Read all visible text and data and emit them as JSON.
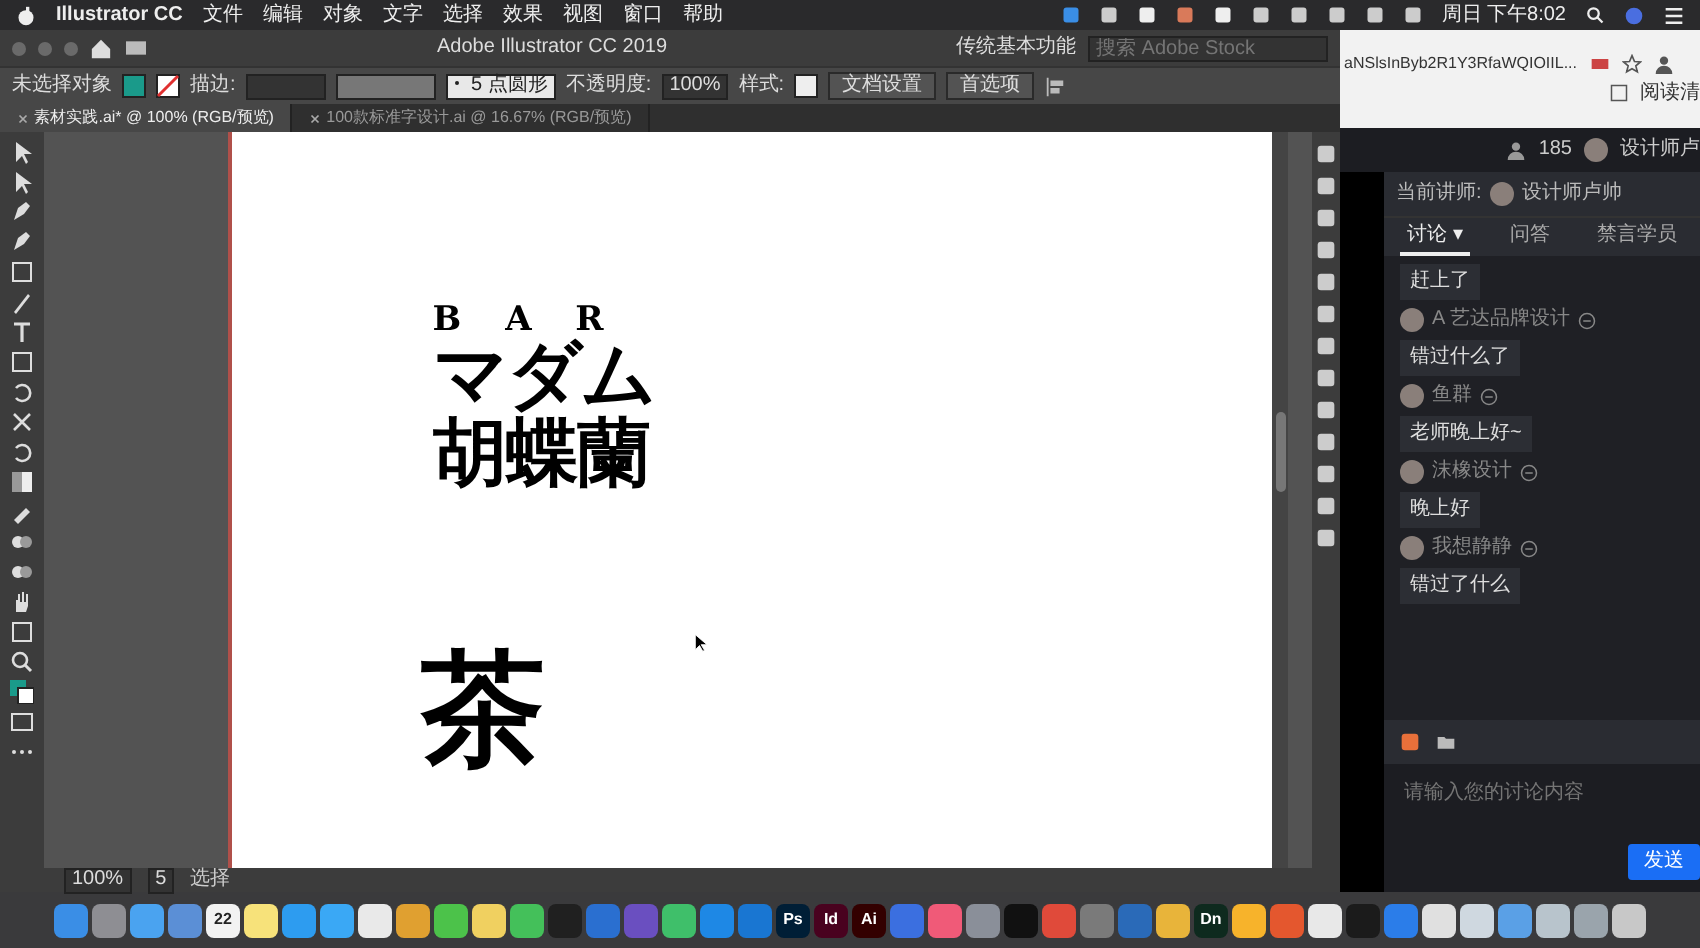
{
  "menubar": {
    "app": "Illustrator CC",
    "menus": [
      "文件",
      "编辑",
      "对象",
      "文字",
      "选择",
      "效果",
      "视图",
      "窗口",
      "帮助"
    ],
    "clock": "周日 下午8:02"
  },
  "illustrator": {
    "title": "Adobe Illustrator CC 2019",
    "workspace": "传统基本功能",
    "search": {
      "placeholder": "搜索 Adobe Stock"
    },
    "control_bar": {
      "selection": "未选择对象",
      "stroke_label": "描边:",
      "brush": "5 点圆形",
      "opacity_label": "不透明度:",
      "opacity": "100%",
      "style_label": "样式:",
      "buttons": [
        "文档设置",
        "首选项"
      ]
    },
    "tabs": [
      {
        "label": "素材实践.ai* @ 100% (RGB/预览)",
        "selected": true
      },
      {
        "label": "100款标准字设计.ai @ 16.67% (RGB/预览)",
        "selected": false
      }
    ],
    "artboard": {
      "texts": [
        {
          "kind": "latin",
          "text": "B A R"
        },
        {
          "kind": "heading",
          "text": "マダム"
        },
        {
          "kind": "heading",
          "text": "胡蝶蘭"
        },
        {
          "kind": "vertical",
          "text": "茶"
        }
      ]
    },
    "status_bar": {
      "zoom": "100%",
      "page": "5",
      "tool": "选择"
    }
  },
  "browser": {
    "url": "aNSlsInByb2R1Y3RfaWQIOIIL...",
    "reading_list": "阅读清"
  },
  "chat": {
    "viewers": "185",
    "host": "设计师卢",
    "lecturer_label": "当前讲师:",
    "lecturer": "设计师卢帅",
    "tabs": [
      {
        "label": "讨论 ▾",
        "selected": true
      },
      {
        "label": "问答",
        "selected": false
      },
      {
        "label": "禁言学员",
        "selected": false
      }
    ],
    "messages": [
      {
        "text": "赶上了"
      },
      {
        "user": "A 艺达品牌设计",
        "text": "错过什么了"
      },
      {
        "user": "鱼群",
        "text": "老师晚上好~"
      },
      {
        "user": "沫橡设计",
        "text": "晚上好"
      },
      {
        "user": "我想静静",
        "text": "错过了什么"
      }
    ],
    "input": {
      "placeholder": "请输入您的讨论内容"
    },
    "send": "发送"
  },
  "dock": [
    {
      "color": "#3a8ee6"
    },
    {
      "color": "#8e8e93"
    },
    {
      "color": "#4aa3f0"
    },
    {
      "color": "#5b8fd6"
    },
    {
      "label": "22",
      "color": "#f2f2f2"
    },
    {
      "color": "#f7e27a"
    },
    {
      "color": "#2d9cf0"
    },
    {
      "color": "#3aa8f5"
    },
    {
      "color": "#e9e9e9"
    },
    {
      "color": "#e0a030"
    },
    {
      "color": "#4cc24a"
    },
    {
      "color": "#f0d060"
    },
    {
      "color": "#44c05a"
    },
    {
      "color": "#202020"
    },
    {
      "color": "#2a6fd0"
    },
    {
      "color": "#6a4fc0"
    },
    {
      "color": "#3fbf6a"
    },
    {
      "color": "#1e88e5"
    },
    {
      "color": "#1976d2"
    },
    {
      "label": "Ps",
      "color": "#001e36"
    },
    {
      "label": "Id",
      "color": "#49021f"
    },
    {
      "label": "Ai",
      "color": "#330000"
    },
    {
      "color": "#3b6fe0"
    },
    {
      "color": "#f05a78"
    },
    {
      "color": "#8a8f99"
    },
    {
      "color": "#111111"
    },
    {
      "color": "#e04a3a"
    },
    {
      "color": "#7a7a7a"
    },
    {
      "color": "#2a6ab8"
    },
    {
      "color": "#e8b43a"
    },
    {
      "label": "Dn",
      "color": "#0e2a1e"
    },
    {
      "color": "#f7b32b"
    },
    {
      "color": "#e4572e"
    },
    {
      "color": "#e8e8e8"
    },
    {
      "color": "#1b1b1b"
    },
    {
      "color": "#2b7de9"
    },
    {
      "color": "#e0e0e0"
    },
    {
      "color": "#cfd8e0"
    },
    {
      "color": "#5aa0e6"
    },
    {
      "color": "#b8c4cc"
    },
    {
      "color": "#9aa4ac"
    },
    {
      "color": "#c8c8c8"
    }
  ]
}
